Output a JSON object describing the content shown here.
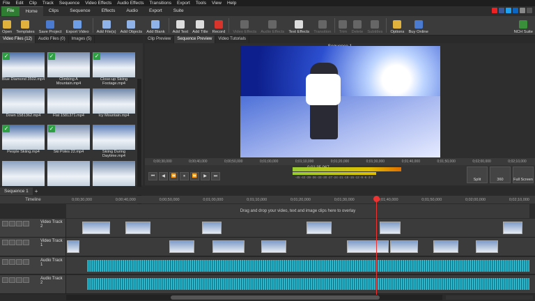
{
  "menu": [
    "File",
    "Edit",
    "Clip",
    "Track",
    "Sequence",
    "Video Effects",
    "Audio Effects",
    "Transitions",
    "Export",
    "Tools",
    "View",
    "Help"
  ],
  "tabs": [
    "File",
    "Home",
    "Clips",
    "Sequence",
    "Effects",
    "Audio",
    "Export",
    "Suite"
  ],
  "toolbar": [
    {
      "label": "Open",
      "icon": "folder-icon",
      "color": "#e2b33c"
    },
    {
      "label": "Templates",
      "icon": "templates-icon",
      "color": "#e2b33c"
    },
    {
      "label": "Save Project",
      "icon": "save-icon",
      "color": "#4a7bd1"
    },
    {
      "label": "Export Video",
      "icon": "export-icon",
      "color": "#6d9ee6"
    },
    {
      "label": "Add File(s)",
      "icon": "add-file-icon",
      "color": "#8fb3e8"
    },
    {
      "label": "Add Objects",
      "icon": "add-objects-icon",
      "color": "#8fb3e8"
    },
    {
      "label": "Add Blank",
      "icon": "add-blank-icon",
      "color": "#8fb3e8"
    },
    {
      "label": "Add Text",
      "icon": "add-text-icon",
      "color": "#ddd"
    },
    {
      "label": "Add Title",
      "icon": "add-title-icon",
      "color": "#ddd"
    },
    {
      "label": "Record",
      "icon": "record-icon",
      "color": "#d9342b"
    },
    {
      "label": "Video Effects",
      "icon": "video-effects-icon",
      "color": "#666",
      "disabled": true
    },
    {
      "label": "Audio Effects",
      "icon": "audio-effects-icon",
      "color": "#666",
      "disabled": true
    },
    {
      "label": "Text Effects",
      "icon": "text-effects-icon",
      "color": "#ddd"
    },
    {
      "label": "Transition",
      "icon": "transition-icon",
      "color": "#666",
      "disabled": true
    },
    {
      "label": "Trim",
      "icon": "trim-icon",
      "color": "#666",
      "disabled": true
    },
    {
      "label": "Delete",
      "icon": "delete-icon",
      "color": "#666",
      "disabled": true
    },
    {
      "label": "Subtitles",
      "icon": "subtitles-icon",
      "color": "#666",
      "disabled": true
    },
    {
      "label": "Options",
      "icon": "options-icon",
      "color": "#e2b33c"
    },
    {
      "label": "Buy Online",
      "icon": "buy-online-icon",
      "color": "#4a7bd1"
    },
    {
      "label": "NCH Suite",
      "icon": "nch-suite-icon",
      "color": "#3a8f3a"
    }
  ],
  "media_tabs": [
    "Video Files (12)",
    "Audio Files (0)",
    "Images (5)"
  ],
  "clips": [
    {
      "name": "Blue Diamond 3502.mp4",
      "checked": true
    },
    {
      "name": "Climbing A Mountain.mp4",
      "checked": true
    },
    {
      "name": "Close-up Skiing Footage.mp4",
      "checked": true
    },
    {
      "name": "Down 1581362.mp4",
      "checked": false
    },
    {
      "name": "Flat 1581371.mp4",
      "checked": false
    },
    {
      "name": "Icy Mountain.mp4",
      "checked": false
    },
    {
      "name": "People Skiing.mp4",
      "checked": true
    },
    {
      "name": "Ski Poles 22.mp4",
      "checked": true
    },
    {
      "name": "Skiing During Daytime.mp4",
      "checked": false
    },
    {
      "name": "",
      "checked": false
    },
    {
      "name": "",
      "checked": false
    },
    {
      "name": "",
      "checked": false
    }
  ],
  "preview_tabs": [
    "Clip Preview",
    "Sequence Preview",
    "Video Tutorials"
  ],
  "sequence_title": "Sequence 1",
  "preview_ruler": [
    "0;00;30,000",
    "0;00;40,000",
    "0;00;50,000",
    "0;01;00,000",
    "0;01;10,000",
    "0;01;20,000",
    "0;01;30,000",
    "0;01;40,000",
    "0;01;50,000",
    "0;02;00,000",
    "0;02;10,000"
  ],
  "current_time": "0:01:35.067",
  "meter_scale": "-45 -42 -39 -36 -33 -30 -27 -24 -21 -18 -15 -12 -9 -6 -3 0",
  "split_label": "Split",
  "vr_label": "360",
  "fullscreen_label": "Full Screen",
  "timeline_tab": "Sequence 1",
  "timeline_label": "Timeline",
  "timeline_ticks": [
    "0;00;30,000",
    "0;00;40,000",
    "0;00;50,000",
    "0;01;00,000",
    "0;01;10,000",
    "0;01;20,000",
    "0;01;30,000",
    "0;01;40,000",
    "0;01;50,000",
    "0;02;00,000",
    "0;02;10,000"
  ],
  "overlay_hint": "Drag and drop your video, text and image clips here to overlay",
  "tracks": [
    "Video Track 2",
    "Video Track 1",
    "Audio Track 1",
    "Audio Track 2"
  ]
}
